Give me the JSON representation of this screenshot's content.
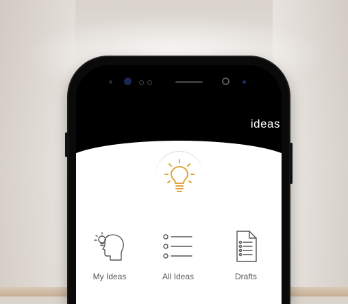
{
  "app": {
    "title": "ideas"
  },
  "nav": {
    "items": [
      {
        "label": "My Ideas",
        "icon": "head-bulb-icon"
      },
      {
        "label": "All Ideas",
        "icon": "list-icon"
      },
      {
        "label": "Drafts",
        "icon": "document-icon"
      }
    ]
  },
  "colors": {
    "accent": "#e0a53a",
    "screen_top": "#000000",
    "screen_bottom": "#ffffff"
  }
}
